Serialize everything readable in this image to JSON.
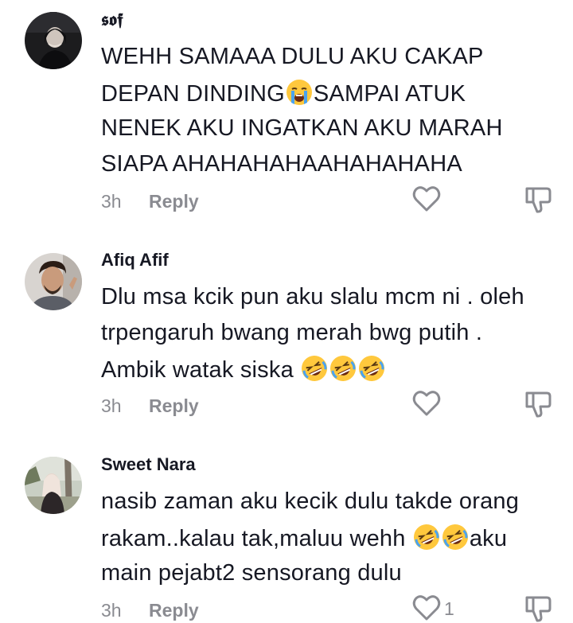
{
  "comments": [
    {
      "username": "𝖘𝖔𝖋⁣",
      "lines": [
        "WEHH SAMAAA DULU AKU CAKAP",
        "DEPAN DINDING",
        "SAMPAI ATUK",
        "NENEK AKU INGATKAN AKU MARAH",
        "SIAPA AHAHAHAHAAHAHAHAHA"
      ],
      "time": "3h",
      "reply": "Reply",
      "likes": ""
    },
    {
      "username": "Afiq Afif",
      "lines": [
        "Dlu msa kcik pun aku slalu mcm ni . oleh",
        "trpengaruh bwang merah bwg putih .",
        "Ambik watak siska "
      ],
      "time": "3h",
      "reply": "Reply",
      "likes": ""
    },
    {
      "username": "Sweet Nara",
      "lines": [
        "nasib zaman aku kecik dulu takde orang",
        "rakam..kalau tak,maluu wehh ",
        "aku",
        "main pejabt2 sensorang dulu"
      ],
      "time": "3h",
      "reply": "Reply",
      "likes": "1"
    }
  ],
  "icons": {
    "like": "heart-outline-icon",
    "dislike": "thumbs-down-icon",
    "emoji_crying": "loudly-crying-face-emoji",
    "emoji_laughing": "rolling-on-floor-laughing-emoji"
  },
  "colors": {
    "text": "#161823",
    "muted": "#8a8b91",
    "emoji_yellow": "#ffc83d"
  }
}
